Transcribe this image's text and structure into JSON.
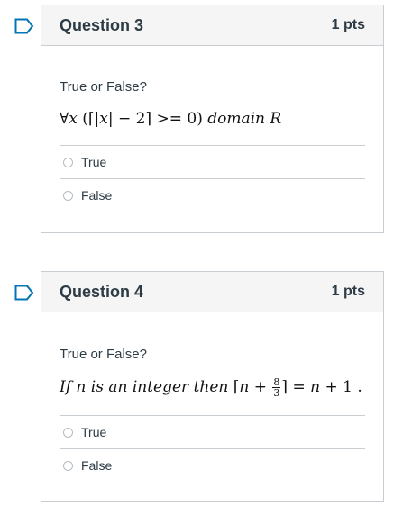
{
  "questions": [
    {
      "title": "Question 3",
      "points": "1 pts",
      "prompt": "True or False?",
      "statement": {
        "forall": "∀",
        "var": "x",
        "part1": " (⌈|",
        "var2": "x",
        "part2": "| − 2⌉ >= 0) ",
        "domain_word": "domain",
        "domain_set": "R"
      },
      "answers": [
        "True",
        "False"
      ]
    },
    {
      "title": "Question 4",
      "points": "1 pts",
      "prompt": "True or False?",
      "statement": {
        "lead": "If n is an integer then ",
        "ceil_open": "⌈",
        "n1": "n",
        "plus": " + ",
        "frac_num": "8",
        "frac_den": "3",
        "ceil_close": "⌉ = ",
        "n2": "n",
        "tail": " + 1 ."
      },
      "answers": [
        "True",
        "False"
      ]
    }
  ],
  "colors": {
    "accent": "#0374b5",
    "border": "#c7cdd1",
    "header_bg": "#f5f5f5",
    "text": "#2d3b45"
  },
  "icons": {
    "flag": "bookmark-flag-icon",
    "radio": "radio-unchecked-icon"
  }
}
